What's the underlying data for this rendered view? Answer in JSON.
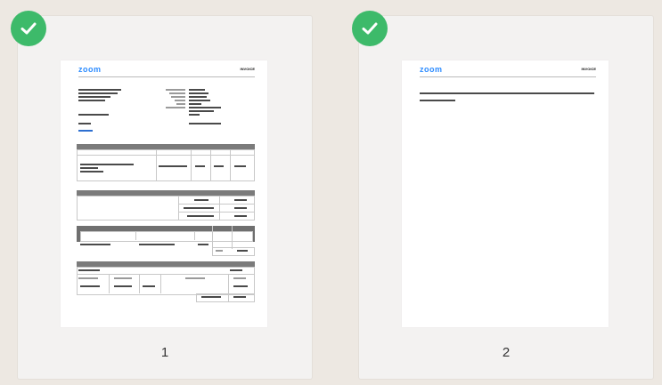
{
  "pages": [
    {
      "number": "1",
      "logo": "zoom",
      "doc_title": "INVOICE",
      "selected": true
    },
    {
      "number": "2",
      "logo": "zoom",
      "doc_title": "INVOICE",
      "selected": true
    }
  ],
  "icons": {
    "selected_badge": "check-circle-icon"
  },
  "colors": {
    "check": "#3dba6a",
    "brand": "#2d8cff",
    "background": "#ede8e2",
    "card": "#f3f2f1"
  }
}
